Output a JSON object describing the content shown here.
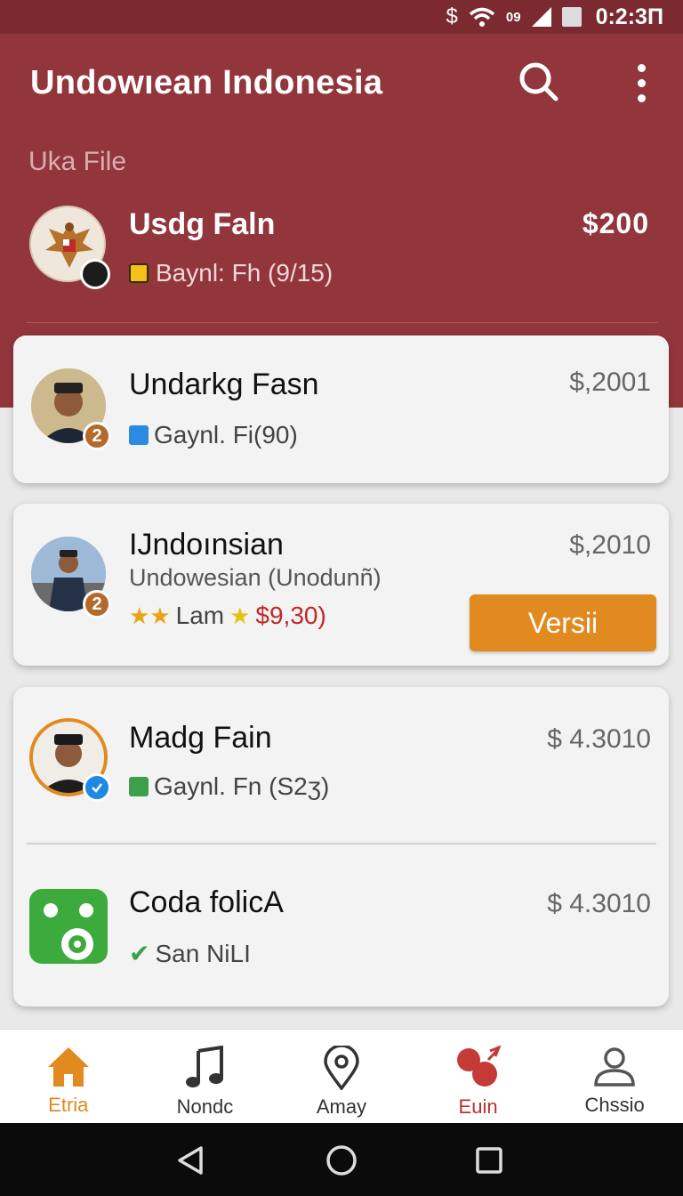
{
  "status_bar": {
    "bluetooth": "$",
    "signal_text": "09",
    "time": "0:2:3Π"
  },
  "app_bar": {
    "title": "Undowıean Indonesia",
    "search_icon": "search-icon",
    "more_icon": "more-vert-icon"
  },
  "section_label": "Uka File",
  "featured": {
    "name": "Usdg Faln",
    "price": "$200",
    "subtitle": "Baynl: Fh (9/15)"
  },
  "items": [
    {
      "name": "Undarkg Fasn",
      "price": "$,2001",
      "subtitle": "Gaynl. Fi(90)",
      "badge": "2"
    },
    {
      "name": "IJndoınsian",
      "price": "$,2010",
      "line2": "Undowesian (Unodunñ)",
      "rating_text": "Lam",
      "rating_price": "$9,30)",
      "badge": "2",
      "action_label": "Versii"
    },
    {
      "name": "Madg Fain",
      "price": "$ 4.3010",
      "subtitle": "Gaynl. Fn (S2ʒ)"
    },
    {
      "name": "Coda folicA",
      "price": "$ 4.3010",
      "subtitle": "San NiLI"
    }
  ],
  "bottom_nav": [
    {
      "label": "Etria",
      "icon": "home-icon"
    },
    {
      "label": "Nondc",
      "icon": "music-note-icon"
    },
    {
      "label": "Amay",
      "icon": "location-pin-icon"
    },
    {
      "label": "Euin",
      "icon": "balloons-icon"
    },
    {
      "label": "Chssio",
      "icon": "person-icon"
    }
  ],
  "colors": {
    "primary": "#93363c",
    "accent": "#e08a1f",
    "status": "#7a2a30"
  }
}
